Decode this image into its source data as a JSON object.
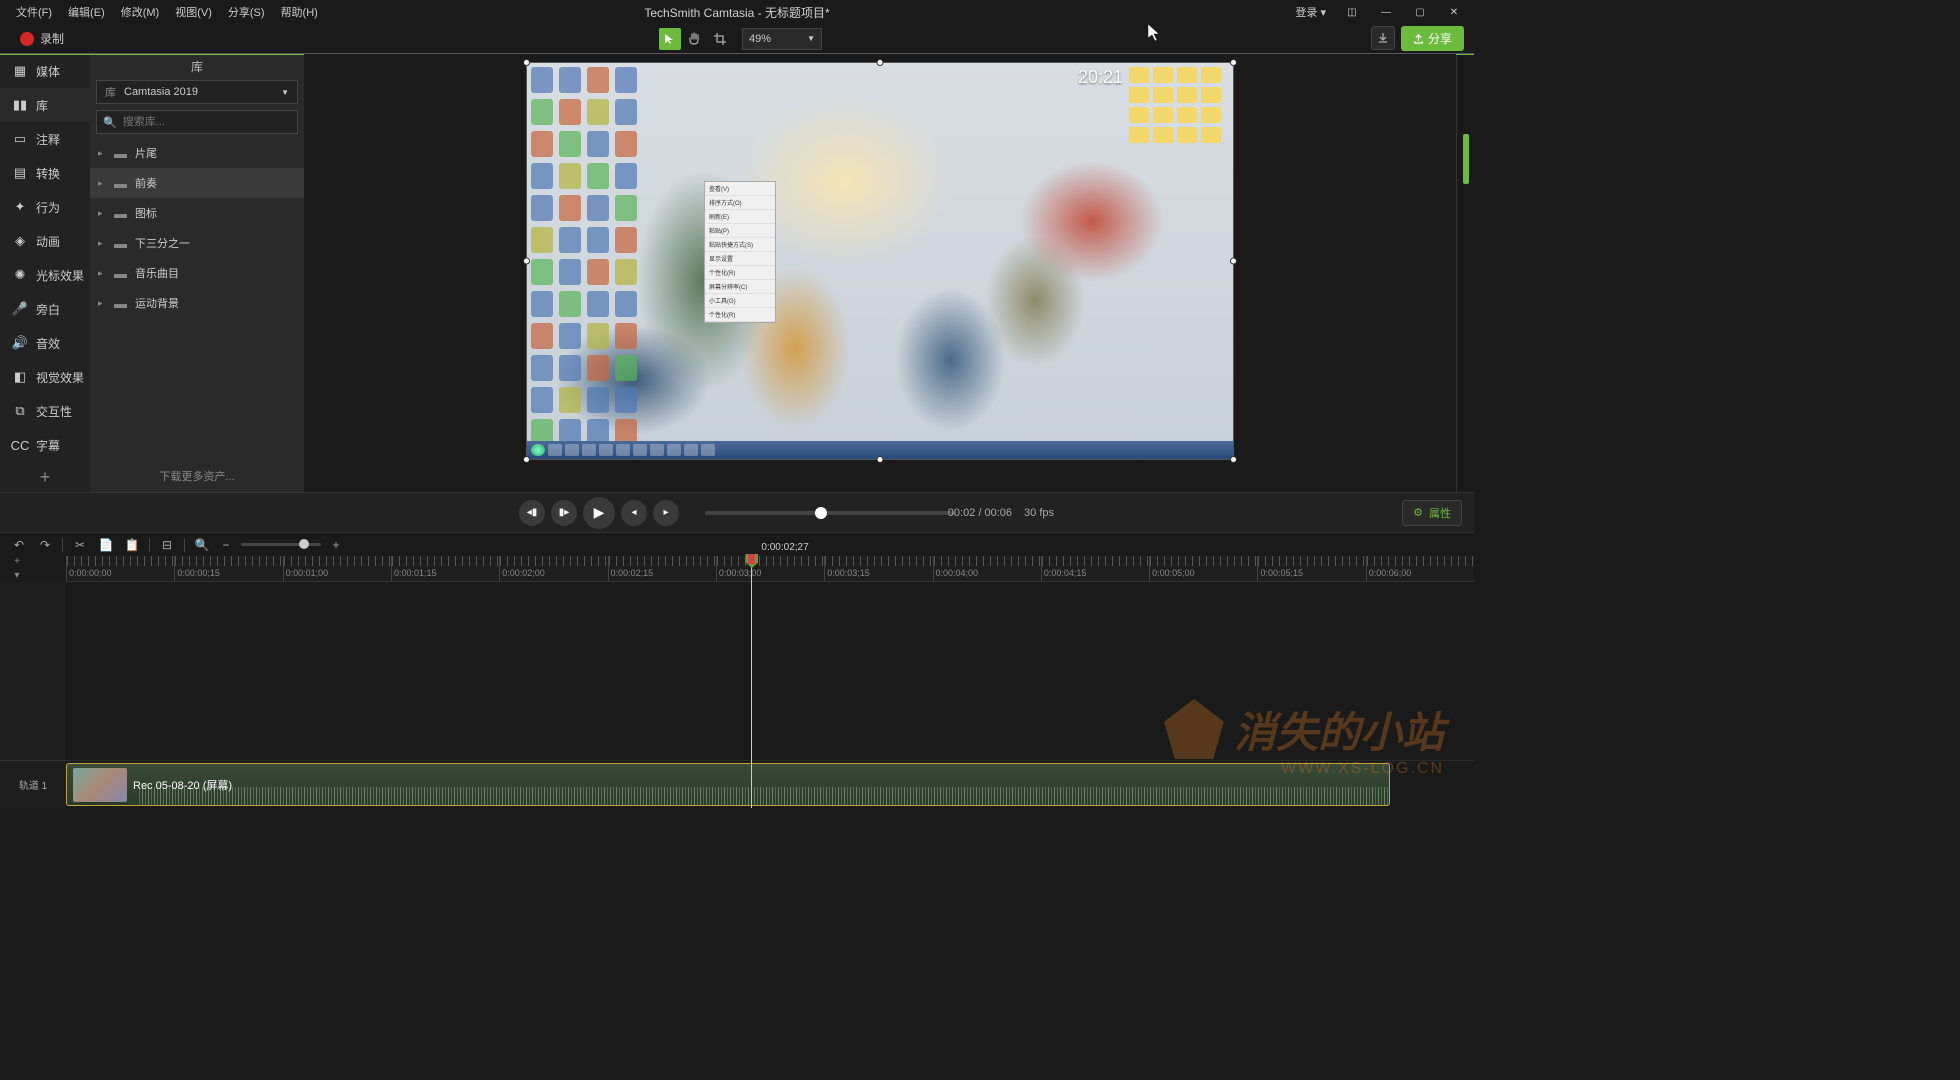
{
  "menu": {
    "file": "文件(F)",
    "edit": "编辑(E)",
    "modify": "修改(M)",
    "view": "视图(V)",
    "share": "分享(S)",
    "help": "帮助(H)"
  },
  "title": "TechSmith Camtasia - 无标题项目*",
  "login": "登录 ▾",
  "record": "录制",
  "zoom": "49%",
  "share_btn": "分享",
  "sidebar": [
    {
      "icon": "▦",
      "label": "媒体"
    },
    {
      "icon": "▮▮",
      "label": "库"
    },
    {
      "icon": "▭",
      "label": "注释"
    },
    {
      "icon": "▤",
      "label": "转换"
    },
    {
      "icon": "✦",
      "label": "行为"
    },
    {
      "icon": "◈",
      "label": "动画"
    },
    {
      "icon": "✺",
      "label": "光标效果"
    },
    {
      "icon": "🎤",
      "label": "旁白"
    },
    {
      "icon": "🔊",
      "label": "音效"
    },
    {
      "icon": "◧",
      "label": "视觉效果"
    },
    {
      "icon": "⧉",
      "label": "交互性"
    },
    {
      "icon": "CC",
      "label": "字幕"
    }
  ],
  "library": {
    "header": "库",
    "select_label": "库",
    "select_value": "Camtasia 2019",
    "search_placeholder": "搜索库...",
    "folders": [
      "片尾",
      "前奏",
      "图标",
      "下三分之一",
      "音乐曲目",
      "运动背景"
    ],
    "download": "下载更多资产..."
  },
  "canvas": {
    "clock": "20:21",
    "context_items": [
      "查看(V)",
      "排序方式(O)",
      "刷新(E)",
      "粘贴(P)",
      "粘贴快捷方式(S)",
      "显示设置",
      "个性化(R)",
      "屏幕分辨率(C)",
      "小工具(G)",
      "个性化(R)"
    ]
  },
  "playback": {
    "time_current": "00:02",
    "time_total": "00:06",
    "fps": "30 fps"
  },
  "properties_btn": "属性",
  "timeline": {
    "playhead_time": "0:00:02;27",
    "ruler": [
      "0:00:00;00",
      "0:00:00;15",
      "0:00:01;00",
      "0:00:01;15",
      "0:00:02;00",
      "0:00:02;15",
      "0:00:03;00",
      "0:00:03;15",
      "0:00:04;00",
      "0:00:04;15",
      "0:00:05;00",
      "0:00:05;15",
      "0:00:06;00"
    ],
    "track_name": "轨道 1",
    "clip_name": "Rec 05-08-20 (屏幕)"
  },
  "watermark": {
    "text": "消失的小站",
    "url": "WWW.XS-LOG.CN"
  }
}
